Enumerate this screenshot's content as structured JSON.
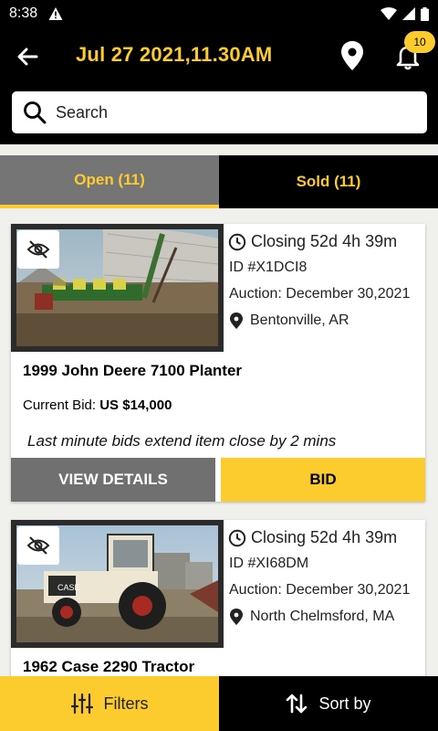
{
  "status_bar": {
    "time": "8:38"
  },
  "header": {
    "title": "Jul 27 2021,11.30AM",
    "notification_count": "10"
  },
  "search": {
    "placeholder": "Search"
  },
  "tabs": [
    {
      "label": "Open (11)",
      "active": true
    },
    {
      "label": "Sold (11)",
      "active": false
    }
  ],
  "listings": [
    {
      "closing": "Closing 52d 4h 39m",
      "lot_id": "ID #X1DCI8",
      "auction": "Auction: December 30,2021",
      "location": "Bentonville, AR",
      "title": "1999 John Deere 7100 Planter",
      "current_bid_label": "Current Bid:",
      "current_bid": "US $14,000",
      "extend_note": "Last minute bids extend item close by 2 mins",
      "details_label": "VIEW DETAILS",
      "bid_label": "BID"
    },
    {
      "closing": "Closing 52d 4h 39m",
      "lot_id": "ID #XI68DM",
      "auction": "Auction: December 30,2021",
      "location": "North Chelmsford, MA",
      "title": "1962 Case 2290 Tractor"
    }
  ],
  "bottom_bar": {
    "filters_label": "Filters",
    "sort_label": "Sort by"
  },
  "colors": {
    "accent": "#fccb2e",
    "header_bg": "#000000",
    "tab_active_bg": "#757575",
    "details_button_bg": "#707070"
  }
}
